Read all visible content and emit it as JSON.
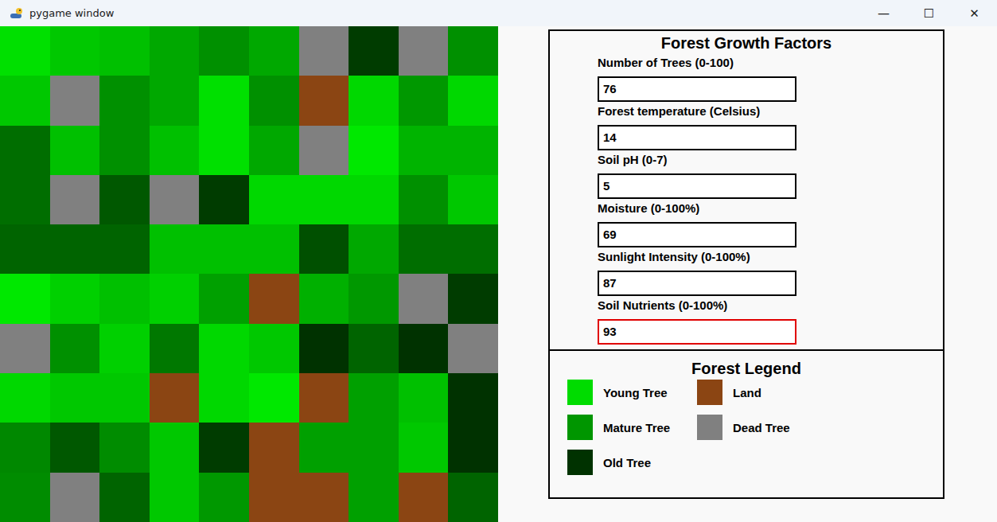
{
  "window": {
    "title": "pygame window",
    "controls": [
      "—",
      "☐",
      "✕"
    ]
  },
  "grid": {
    "rows": [
      [
        "#00e000",
        "#00c800",
        "#00c000",
        "#00a800",
        "#009000",
        "#00a800",
        "#808080",
        "#003c00",
        "#808080",
        "#009000"
      ],
      [
        "#00c800",
        "#808080",
        "#009000",
        "#00a800",
        "#00e000",
        "#009000",
        "#8b4513",
        "#00d800",
        "#009800",
        "#00d800"
      ],
      [
        "#006e00",
        "#00c000",
        "#009000",
        "#00c000",
        "#00e000",
        "#00a800",
        "#808080",
        "#00e800",
        "#00b400",
        "#00b400"
      ],
      [
        "#006e00",
        "#808080",
        "#005800",
        "#808080",
        "#003c00",
        "#00d800",
        "#00d800",
        "#00d800",
        "#009000",
        "#00c800"
      ],
      [
        "#006400",
        "#006400",
        "#006400",
        "#00c000",
        "#00c000",
        "#00c000",
        "#005000",
        "#00a800",
        "#006e00",
        "#006e00"
      ],
      [
        "#00e800",
        "#00d000",
        "#00c000",
        "#00d000",
        "#00a000",
        "#8b4513",
        "#00b000",
        "#009800",
        "#808080",
        "#003c00"
      ],
      [
        "#808080",
        "#009000",
        "#00d000",
        "#007800",
        "#00d800",
        "#00c800",
        "#003200",
        "#006400",
        "#003200",
        "#808080"
      ],
      [
        "#00d800",
        "#00c800",
        "#00c800",
        "#8b4513",
        "#00d800",
        "#00e800",
        "#8b4513",
        "#00a000",
        "#00c000",
        "#003200"
      ],
      [
        "#008800",
        "#005800",
        "#008c00",
        "#00c800",
        "#003c00",
        "#8b4513",
        "#00a000",
        "#00a000",
        "#00c800",
        "#003200"
      ],
      [
        "#008c00",
        "#808080",
        "#006400",
        "#00c800",
        "#009800",
        "#8b4513",
        "#8b4513",
        "#00a000",
        "#8b4513",
        "#006400"
      ]
    ]
  },
  "factors": {
    "title": "Forest Growth Factors",
    "fields": [
      {
        "label": "Number of Trees (0-100)",
        "value": "76",
        "focused": false
      },
      {
        "label": "Forest temperature (Celsius)",
        "value": "14",
        "focused": false
      },
      {
        "label": "Soil pH (0-7)",
        "value": "5",
        "focused": false
      },
      {
        "label": "Moisture (0-100%)",
        "value": "69",
        "focused": false
      },
      {
        "label": "Sunlight Intensity (0-100%)",
        "value": "87",
        "focused": false
      },
      {
        "label": "Soil Nutrients (0-100%)",
        "value": "93",
        "focused": true
      }
    ]
  },
  "legend": {
    "title": "Forest Legend",
    "items": [
      {
        "label": "Young Tree",
        "color": "#00dc00"
      },
      {
        "label": "Land",
        "color": "#8b4513"
      },
      {
        "label": "Mature Tree",
        "color": "#009600"
      },
      {
        "label": "Dead Tree",
        "color": "#808080"
      },
      {
        "label": "Old Tree",
        "color": "#003200"
      }
    ]
  }
}
